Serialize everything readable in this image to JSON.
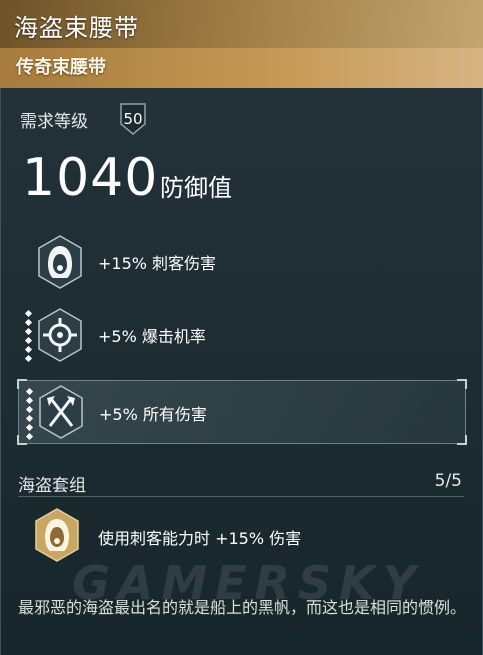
{
  "item": {
    "name": "海盗束腰带",
    "rarity": "传奇束腰带"
  },
  "requirement": {
    "label": "需求等级",
    "level": "50"
  },
  "defense": {
    "value": "1040",
    "label": "防御值"
  },
  "stats": [
    {
      "icon": "assassin-hood-icon",
      "text": "+15% 刺客伤害",
      "highlighted": false
    },
    {
      "icon": "crosshair-icon",
      "text": "+5% 爆击机率",
      "highlighted": false
    },
    {
      "icon": "crossed-axes-icon",
      "text": "+5% 所有伤害",
      "highlighted": true
    }
  ],
  "set": {
    "title": "海盗套组",
    "count": "5/5",
    "icon": "assassin-hood-gold-icon",
    "bonus": "使用刺客能力时 +15% 伤害"
  },
  "description": "最邪恶的海盗最出名的就是船上的黑帆，而这也是相同的惯例。",
  "watermark": "GAMERSKY",
  "colors": {
    "header_gold": "#c89a57",
    "panel_bg": "#1e2e34",
    "set_icon_gold": "#c8a765"
  }
}
